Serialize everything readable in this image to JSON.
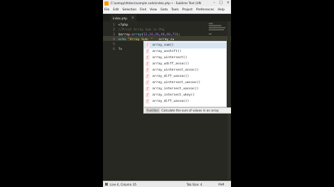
{
  "window": {
    "title": "C:\\xampp\\htdocs\\sample code\\index.php • - Sublime Text (UNREGISTERED)"
  },
  "menu": [
    "File",
    "Edit",
    "Selection",
    "Find",
    "View",
    "Goto",
    "Tools",
    "Project",
    "Preferences",
    "Help"
  ],
  "tab": {
    "label": "index.php"
  },
  "gutter": [
    "1",
    "2",
    "3",
    "4",
    "5",
    "6"
  ],
  "code": {
    "line1": "<?php",
    "line2": "//Print Array Sum in Php",
    "line3": {
      "var": "$array",
      "op": "=",
      "fn": "array",
      "open": "(",
      "nums": [
        "12",
        "24",
        "36",
        "48",
        "60",
        "72"
      ],
      "close": ");"
    },
    "line4": {
      "echo": "echo",
      "str": "\"Array Sum: \"",
      "op": ".",
      "typed": "array_su"
    },
    "line6": "?>"
  },
  "autocomplete": {
    "items": [
      "array_sum()",
      "array_unshift()",
      "array_uintersect()",
      "array_udiff_assoc()",
      "array_uintersect_assoc()",
      "array_diff_uassoc()",
      "array_uintersect_uassoc()",
      "array_intersect_uassoc()",
      "array_intersect_ukey()",
      "array_diff_uassoc()"
    ],
    "kind_glyph": "f",
    "footer_kind": "Function",
    "footer_desc": "Calculate the sum of values in an array"
  },
  "status": {
    "position": "Line 4, Column 35",
    "tab_size": "Tab Size: 4",
    "syntax": "PHP"
  },
  "colors": {
    "editor_bg": "#272822",
    "keyword": "#f92672",
    "function": "#66d9ef",
    "number": "#ae81ff",
    "string": "#e6db74",
    "comment": "#75715e"
  }
}
